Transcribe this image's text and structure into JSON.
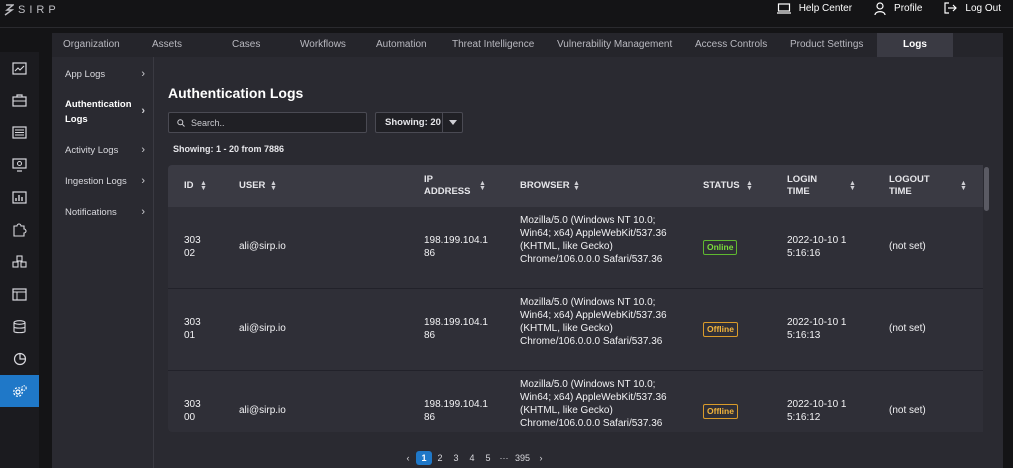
{
  "app": {
    "logo_text": "SIRP"
  },
  "top_actions": {
    "help_center": "Help Center",
    "profile": "Profile",
    "log_out": "Log Out"
  },
  "sidebar_icons": [
    "dashboard-icon",
    "briefcase-icon",
    "list-icon",
    "monitor-icon",
    "bar-chart-icon",
    "puzzle-icon",
    "cubes-icon",
    "report-icon",
    "database-icon",
    "pie-chart-icon",
    "settings-gear-icon"
  ],
  "tabs": [
    {
      "label": "Organization"
    },
    {
      "label": "Assets"
    },
    {
      "label": "Cases"
    },
    {
      "label": "Workflows"
    },
    {
      "label": "Automation"
    },
    {
      "label": "Threat Intelligence"
    },
    {
      "label": "Vulnerability Management"
    },
    {
      "label": "Access Controls"
    },
    {
      "label": "Product Settings"
    },
    {
      "label": "Logs",
      "active": true
    }
  ],
  "subnav": [
    {
      "label": "App Logs"
    },
    {
      "label": "Authentication Logs",
      "active": true
    },
    {
      "label": "Activity Logs"
    },
    {
      "label": "Ingestion Logs"
    },
    {
      "label": "Notifications"
    }
  ],
  "page": {
    "title": "Authentication Logs",
    "search_placeholder": "Search..",
    "showing_label": "Showing: 20",
    "count_text": "Showing: 1 - 20 from 7886"
  },
  "table": {
    "columns": [
      "ID",
      "USER",
      "IP ADDRESS",
      "BROWSER",
      "STATUS",
      "LOGIN TIME",
      "LOGOUT TIME"
    ],
    "rows": [
      {
        "id": "30302",
        "user": "ali@sirp.io",
        "ip": "198.199.104.186",
        "browser": "Mozilla/5.0 (Windows NT 10.0; Win64; x64) AppleWebKit/537.36 (KHTML, like Gecko) Chrome/106.0.0.0 Safari/537.36",
        "status": "Online",
        "login_time": "2022-10-10 15:16:16",
        "logout_time": "(not set)"
      },
      {
        "id": "30301",
        "user": "ali@sirp.io",
        "ip": "198.199.104.186",
        "browser": "Mozilla/5.0 (Windows NT 10.0; Win64; x64) AppleWebKit/537.36 (KHTML, like Gecko) Chrome/106.0.0.0 Safari/537.36",
        "status": "Offline",
        "login_time": "2022-10-10 15:16:13",
        "logout_time": "(not set)"
      },
      {
        "id": "30300",
        "user": "ali@sirp.io",
        "ip": "198.199.104.186",
        "browser": "Mozilla/5.0 (Windows NT 10.0; Win64; x64) AppleWebKit/537.36 (KHTML, like Gecko) Chrome/106.0.0.0 Safari/537.36",
        "status": "Offline",
        "login_time": "2022-10-10 15:16:12",
        "logout_time": "(not set)"
      }
    ]
  },
  "pagination": {
    "prev": "‹",
    "pages": [
      "1",
      "2",
      "3",
      "4",
      "5"
    ],
    "ellipsis": "···",
    "last": "395",
    "next": "›",
    "current": "1"
  },
  "colors": {
    "accent": "#1f78c8",
    "online": "#7bdc3c",
    "offline": "#f3b43b"
  }
}
